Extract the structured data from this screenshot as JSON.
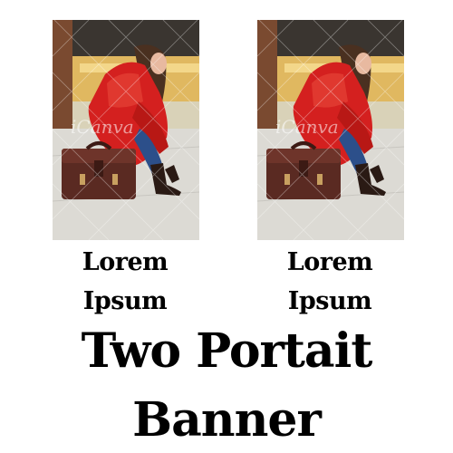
{
  "photos": [
    {
      "watermark": "iCanva",
      "subject": "woman-red-jacket-briefcase"
    },
    {
      "watermark": "iCanva",
      "subject": "woman-red-jacket-briefcase"
    }
  ],
  "captions": [
    {
      "line1": "Lorem",
      "line2": "Ipsum"
    },
    {
      "line1": "Lorem",
      "line2": "Ipsum"
    }
  ],
  "headline": {
    "line1": "Two Portait",
    "line2": "Banner"
  },
  "colors": {
    "background": "#ffffff",
    "text": "#000000",
    "jacket": "#d4201f",
    "bag": "#5a2a22"
  }
}
